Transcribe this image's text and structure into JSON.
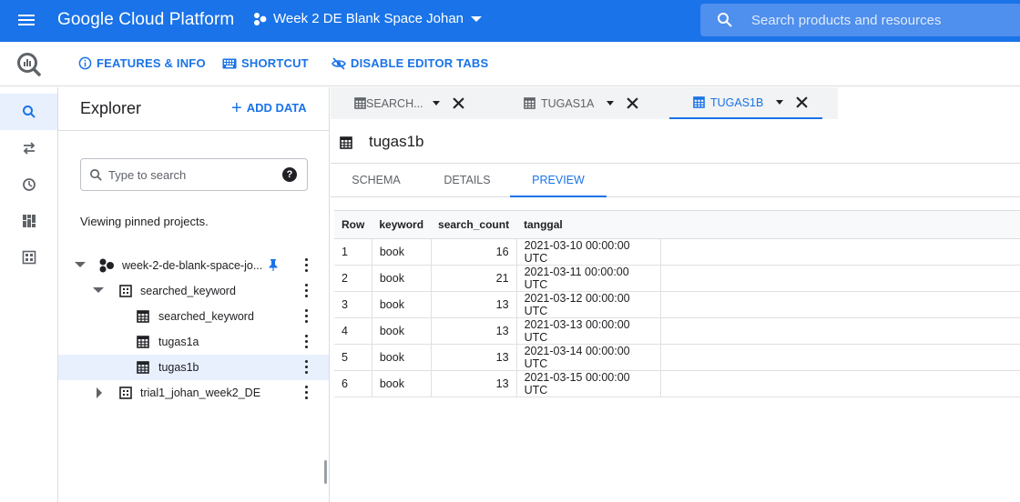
{
  "topbar": {
    "title": "Google Cloud Platform",
    "project": "Week 2 DE Blank Space Johan",
    "search_placeholder": "Search products and resources"
  },
  "toolbar": {
    "features_label": "FEATURES & INFO",
    "shortcut_label": "SHORTCUT",
    "disable_tabs_label": "DISABLE EDITOR TABS"
  },
  "explorer": {
    "title": "Explorer",
    "add_data_label": "ADD DATA",
    "search_placeholder": "Type to search",
    "viewing_text": "Viewing pinned projects.",
    "tree": [
      {
        "label": "week-2-de-blank-space-jo...",
        "type": "project",
        "expanded": true
      },
      {
        "label": "searched_keyword",
        "type": "dataset",
        "expanded": true
      },
      {
        "label": "searched_keyword",
        "type": "table"
      },
      {
        "label": "tugas1a",
        "type": "table"
      },
      {
        "label": "tugas1b",
        "type": "table",
        "selected": true
      },
      {
        "label": "trial1_johan_week2_DE",
        "type": "dataset",
        "expanded": false
      }
    ]
  },
  "editor_tabs": [
    {
      "label": "SEARCH..."
    },
    {
      "label": "TUGAS1A"
    },
    {
      "label": "TUGAS1B",
      "active": true
    }
  ],
  "table_title": "tugas1b",
  "subtabs": [
    "SCHEMA",
    "DETAILS",
    "PREVIEW"
  ],
  "active_subtab": "PREVIEW",
  "preview": {
    "columns": [
      "Row",
      "keyword",
      "search_count",
      "tanggal"
    ],
    "rows": [
      [
        "1",
        "book",
        "16",
        "2021-03-10 00:00:00 UTC"
      ],
      [
        "2",
        "book",
        "21",
        "2021-03-11 00:00:00 UTC"
      ],
      [
        "3",
        "book",
        "13",
        "2021-03-12 00:00:00 UTC"
      ],
      [
        "4",
        "book",
        "13",
        "2021-03-13 00:00:00 UTC"
      ],
      [
        "5",
        "book",
        "13",
        "2021-03-14 00:00:00 UTC"
      ],
      [
        "6",
        "book",
        "13",
        "2021-03-15 00:00:00 UTC"
      ]
    ]
  },
  "colors": {
    "brand": "#1a73e8",
    "selected_bg": "#e8f0fe",
    "border": "#dadce0"
  }
}
